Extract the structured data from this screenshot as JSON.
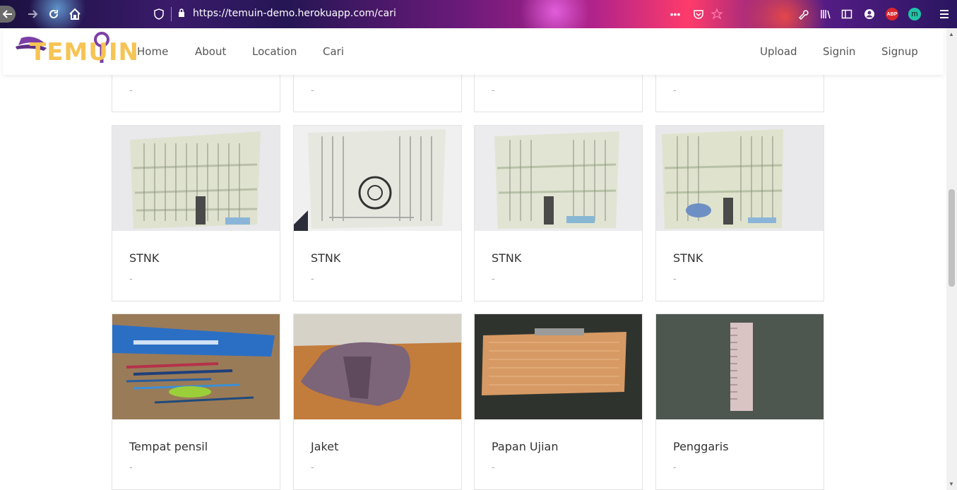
{
  "browser": {
    "url": "https://temuin-demo.herokuapp.com/cari",
    "icons": [
      "back-icon",
      "forward-icon",
      "reload-icon",
      "home-icon",
      "shield-icon",
      "lock-icon",
      "more-icon",
      "pocket-icon",
      "star-icon",
      "wrench-icon",
      "library-icon",
      "sidebar-icon",
      "account-icon",
      "adblock-icon",
      "extension-m-icon",
      "menu-icon"
    ],
    "abp_label": "ABP",
    "ext_label": "m"
  },
  "nav": {
    "logo_text": "TEMUIN",
    "left_links": [
      "Home",
      "About",
      "Location",
      "Cari"
    ],
    "right_links": [
      "Upload",
      "Signin",
      "Signup"
    ]
  },
  "top_row": {
    "descs": [
      "-",
      "-",
      "-",
      "-"
    ]
  },
  "rows": [
    {
      "cards": [
        {
          "title": "STNK",
          "desc": "-",
          "image": "stnk-document-photo"
        },
        {
          "title": "STNK",
          "desc": "-",
          "image": "stnk-document-photo"
        },
        {
          "title": "STNK",
          "desc": "-",
          "image": "stnk-document-photo"
        },
        {
          "title": "STNK",
          "desc": "-",
          "image": "stnk-document-photo"
        }
      ]
    },
    {
      "cards": [
        {
          "title": "Tempat pensil",
          "desc": "-",
          "image": "pencil-case-photo"
        },
        {
          "title": "Jaket",
          "desc": "-",
          "image": "jacket-photo"
        },
        {
          "title": "Papan Ujian",
          "desc": "-",
          "image": "clipboard-photo"
        },
        {
          "title": "Penggaris",
          "desc": "-",
          "image": "ruler-photo"
        }
      ]
    }
  ]
}
